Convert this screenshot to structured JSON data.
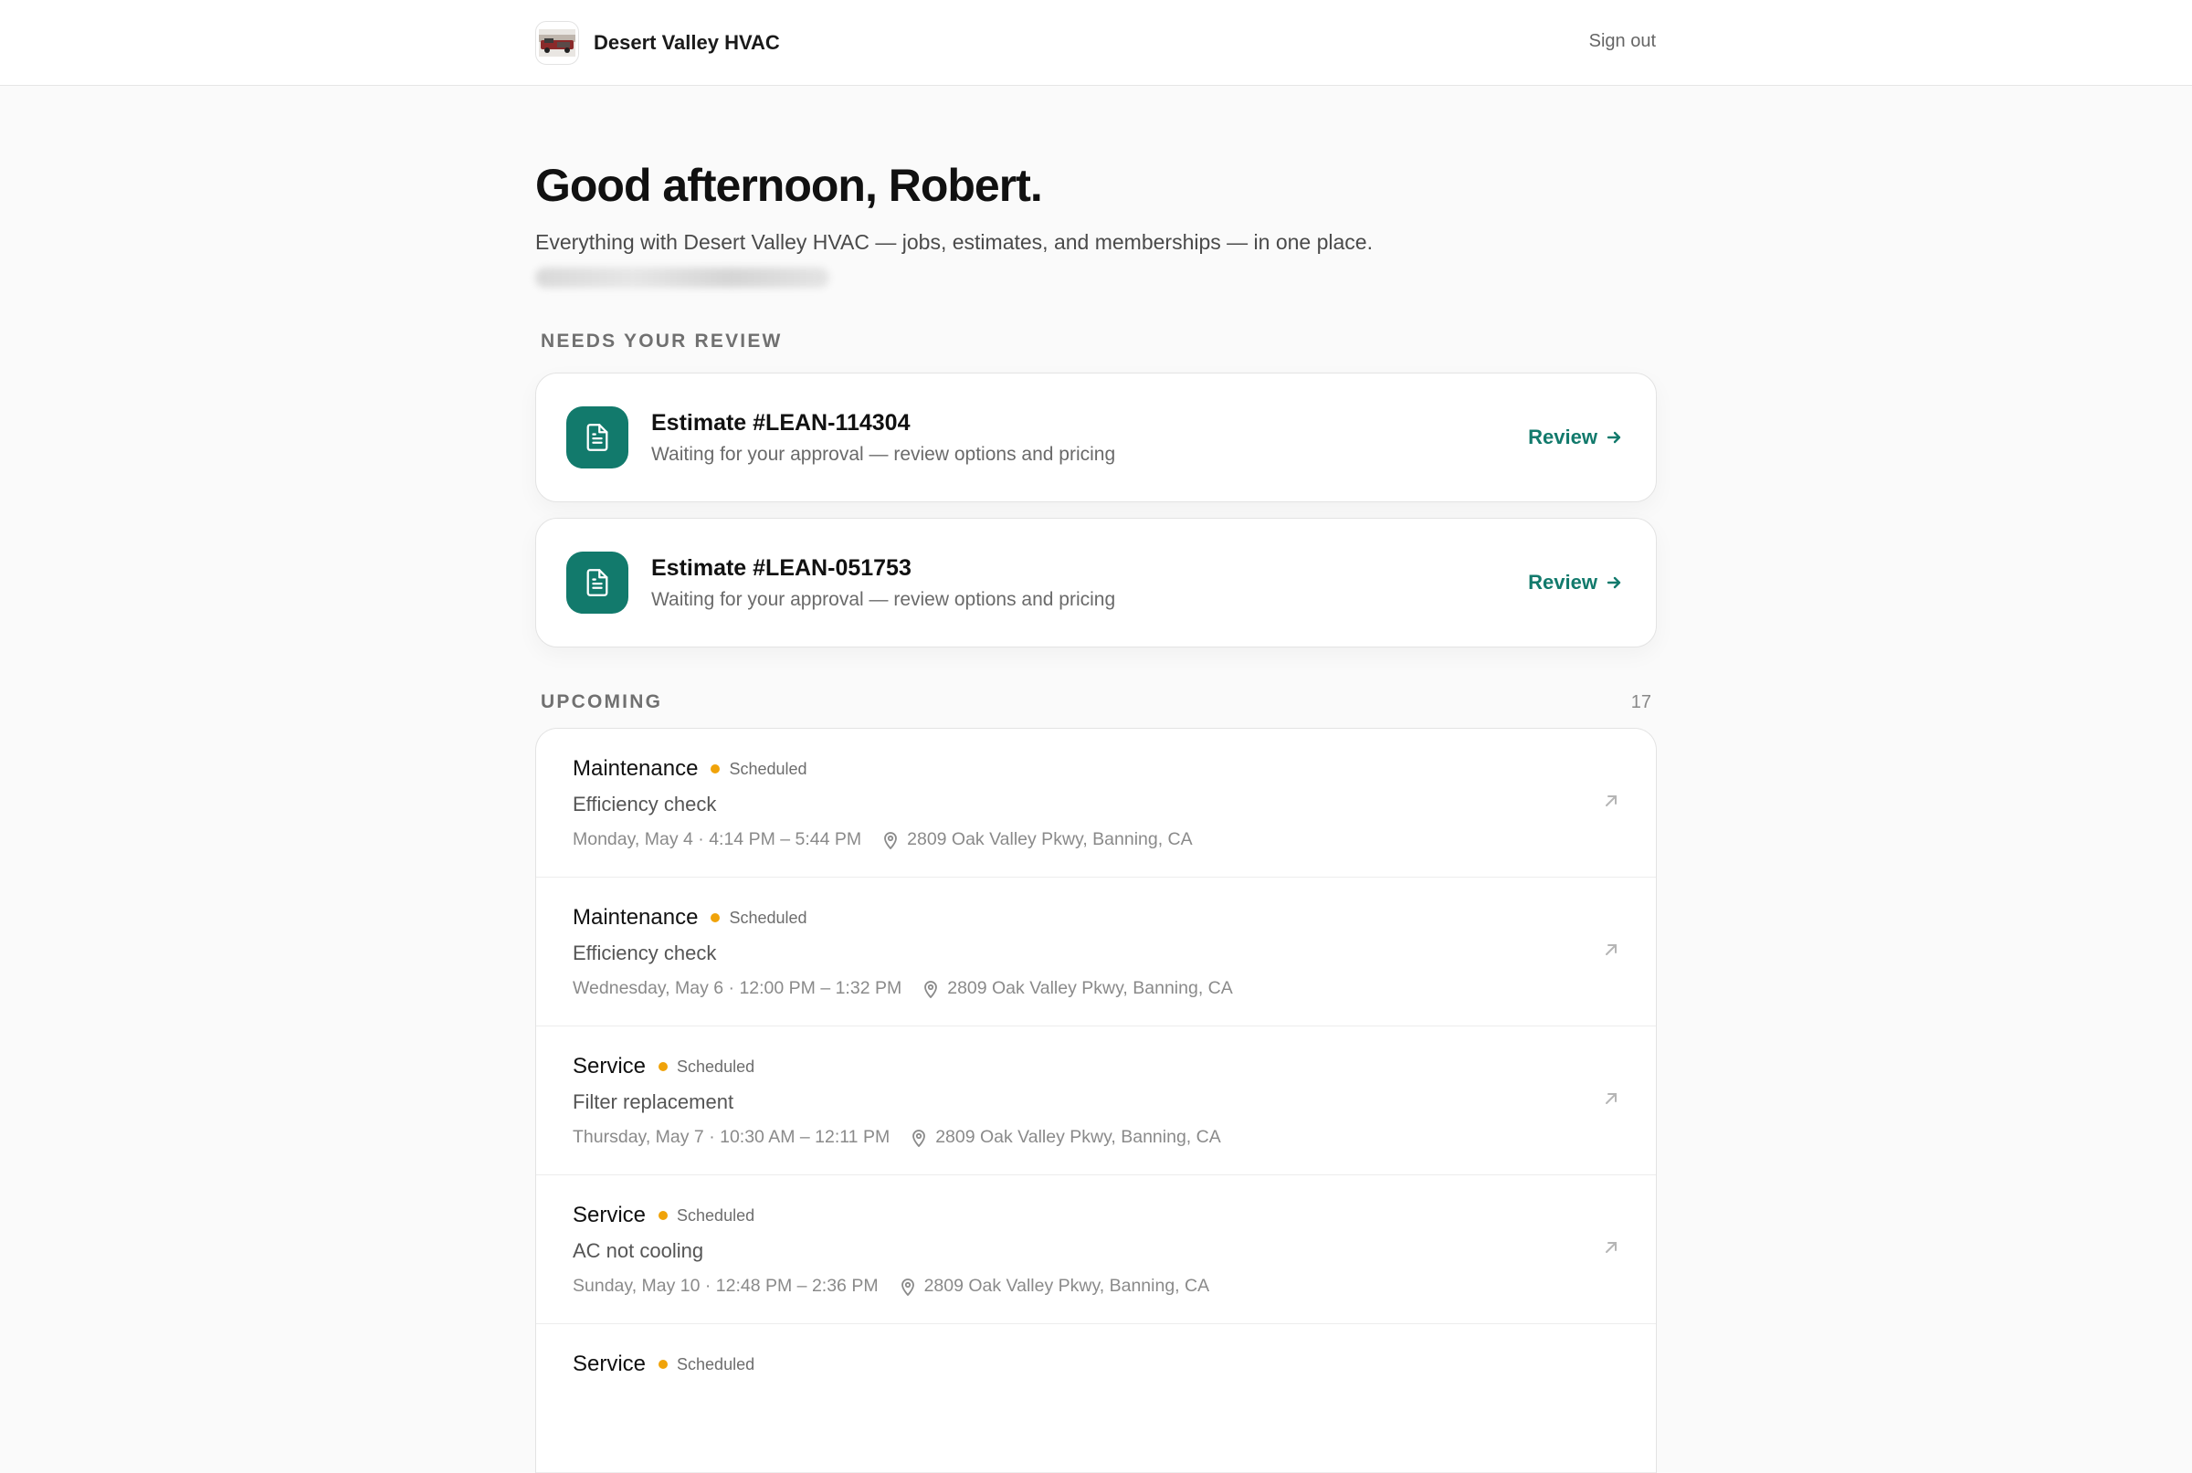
{
  "header": {
    "company": "Desert Valley HVAC",
    "signout_label": "Sign out"
  },
  "hero": {
    "greeting": "Good afternoon, Robert.",
    "subtitle": "Everything with Desert Valley HVAC — jobs, estimates, and memberships — in one place."
  },
  "review": {
    "section_title": "NEEDS YOUR REVIEW",
    "items": [
      {
        "title": "Estimate #LEAN-114304",
        "subtitle": "Waiting for your approval — review options and pricing",
        "action": "Review"
      },
      {
        "title": "Estimate #LEAN-051753",
        "subtitle": "Waiting for your approval — review options and pricing",
        "action": "Review"
      }
    ]
  },
  "upcoming": {
    "section_title": "UPCOMING",
    "count": "17",
    "items": [
      {
        "type": "Maintenance",
        "status": "Scheduled",
        "description": "Efficiency check",
        "time": "Monday, May 4 · 4:14 PM – 5:44 PM",
        "address": "2809 Oak Valley Pkwy, Banning, CA"
      },
      {
        "type": "Maintenance",
        "status": "Scheduled",
        "description": "Efficiency check",
        "time": "Wednesday, May 6 · 12:00 PM – 1:32 PM",
        "address": "2809 Oak Valley Pkwy, Banning, CA"
      },
      {
        "type": "Service",
        "status": "Scheduled",
        "description": "Filter replacement",
        "time": "Thursday, May 7 · 10:30 AM – 12:11 PM",
        "address": "2809 Oak Valley Pkwy, Banning, CA"
      },
      {
        "type": "Service",
        "status": "Scheduled",
        "description": "AC not cooling",
        "time": "Sunday, May 10 · 12:48 PM – 2:36 PM",
        "address": "2809 Oak Valley Pkwy, Banning, CA"
      },
      {
        "type": "Service",
        "status": "Scheduled",
        "description": "",
        "time": "",
        "address": ""
      }
    ]
  },
  "colors": {
    "accent": "#127a6c",
    "status_dot": "#f0a30a"
  },
  "icons": {
    "logo": "company-logo-photo",
    "document": "document-icon",
    "arrow": "arrow-right-icon",
    "pin": "location-pin-icon",
    "open": "arrow-up-right-icon"
  }
}
